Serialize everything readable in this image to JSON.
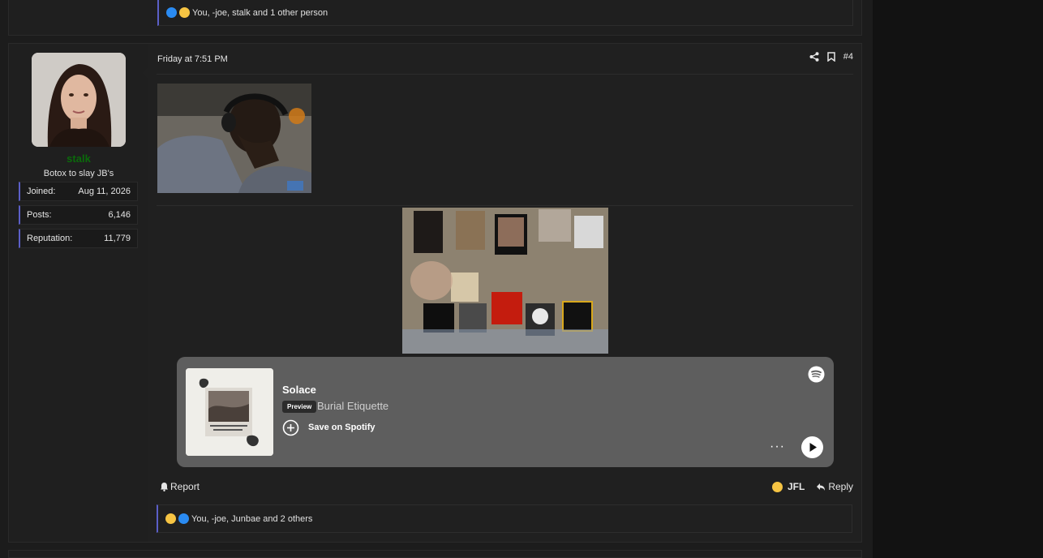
{
  "prev_post": {
    "reactions_text": "You, -joe, stalk and 1 other person"
  },
  "post": {
    "user": {
      "name": "stalk",
      "title": "Botox to slay JB's",
      "stats": [
        {
          "label": "Joined:",
          "value": "Aug 11, 2026"
        },
        {
          "label": "Posts:",
          "value": "6,146"
        },
        {
          "label": "Reputation:",
          "value": "11,779"
        }
      ]
    },
    "date": "Friday at 7:51 PM",
    "post_number": "#4",
    "spotify": {
      "title": "Solace",
      "preview_badge": "Preview",
      "artist": "Burial Etiquette",
      "save_label": "Save on Spotify",
      "more": "···"
    },
    "footer": {
      "report_label": "Report",
      "reaction_label": "JFL",
      "reply_label": "Reply"
    },
    "reactions_text": "You, -joe, Junbae and 2 others"
  },
  "colors": {
    "username": "#0b6a0b",
    "accent_border": "#5b5fc7",
    "spotify_bg": "#5e5e5e"
  },
  "icons": [
    "like-icon",
    "laugh-icon",
    "share-icon",
    "bookmark-icon",
    "spotify-icon",
    "add-circle-icon",
    "play-icon",
    "bell-icon",
    "reply-icon"
  ]
}
